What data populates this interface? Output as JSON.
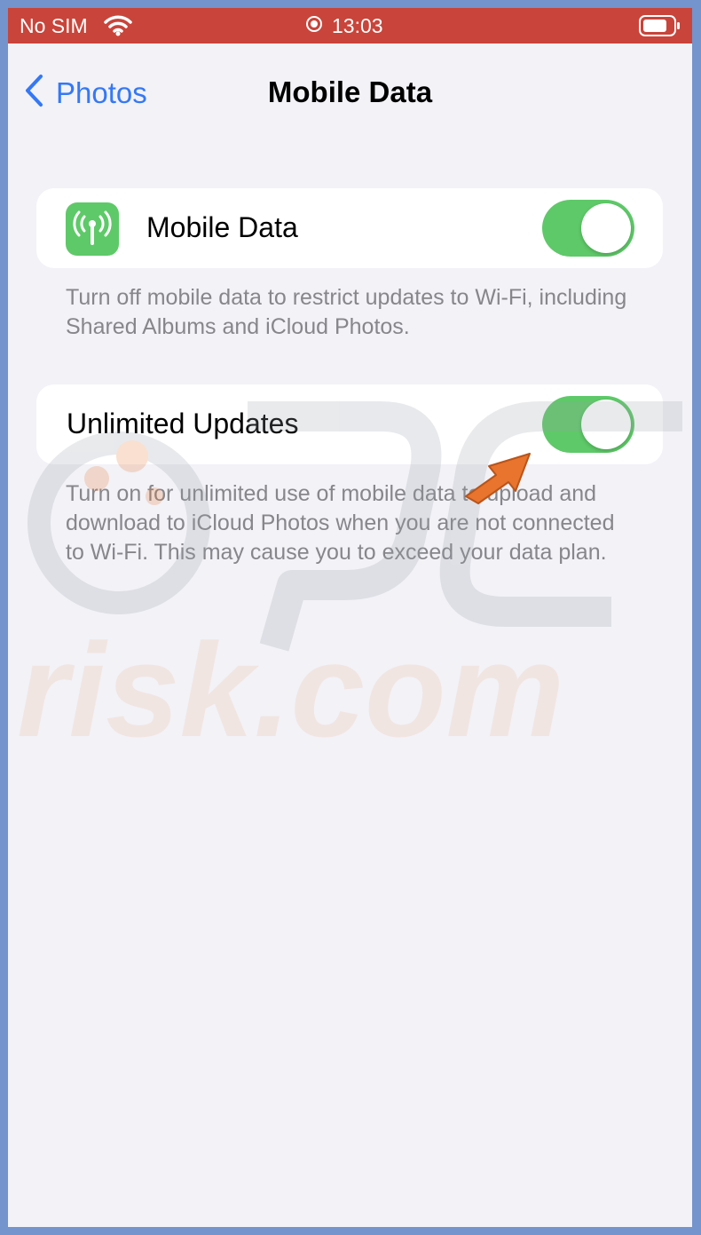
{
  "status_bar": {
    "carrier": "No SIM",
    "time": "13:03",
    "icons": [
      "wifi-icon",
      "location-icon",
      "battery-icon"
    ],
    "background_color": "#c9443a"
  },
  "nav": {
    "back_label": "Photos",
    "title": "Mobile Data",
    "accent_color": "#3478f6"
  },
  "mobile_data": {
    "label": "Mobile Data",
    "icon": "antenna-icon",
    "icon_color": "#5ec968",
    "enabled": true,
    "footnote": "Turn off mobile data to restrict updates to Wi-Fi, including Shared Albums and iCloud Photos."
  },
  "unlimited_updates": {
    "label": "Unlimited Updates",
    "enabled": true,
    "footnote": "Turn on for unlimited use of mobile data to upload and download to iCloud Photos when you are not connected to Wi-Fi. This may cause you to exceed your data plan."
  },
  "watermark": {
    "text": "risk.com"
  },
  "annotation": {
    "icon": "pointer-arrow-icon",
    "color": "#e8742d"
  },
  "colors": {
    "toggle_on": "#5ec968",
    "page_background": "#f2f2f7",
    "frame_border": "#7394cc"
  }
}
